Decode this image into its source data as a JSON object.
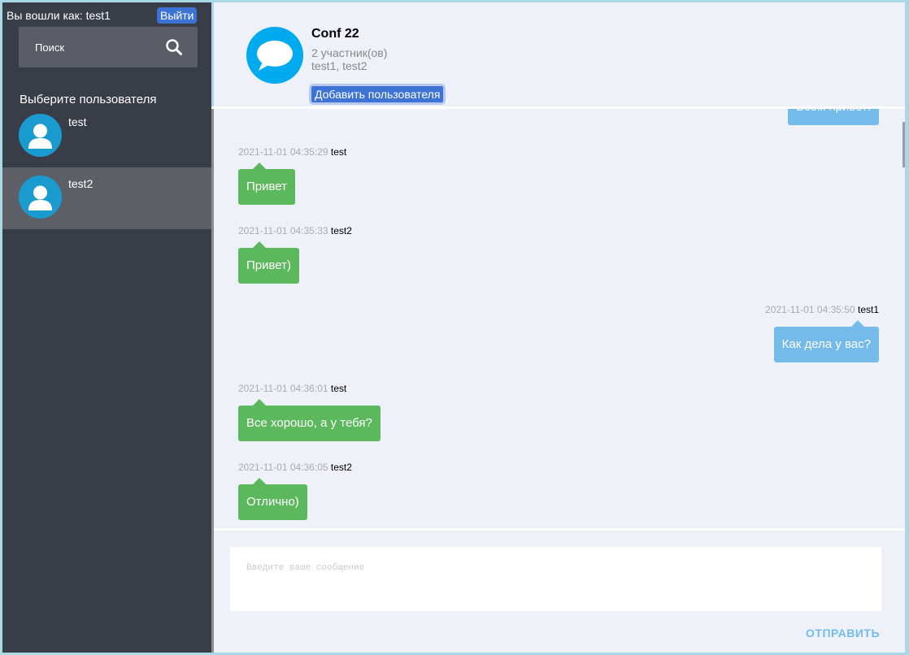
{
  "sidebar": {
    "logged_in_label": "Вы вошли как: test1",
    "logout_label": "Выйти",
    "search_placeholder": "Поиск",
    "choose_user_label": "Выберите пользователя",
    "users": [
      {
        "name": "test",
        "active": false
      },
      {
        "name": "test2",
        "active": true
      }
    ]
  },
  "conversation": {
    "title": "Conf 22",
    "participant_count": "2 участник(ов)",
    "members": "test1, test2",
    "add_user_label": "Добавить пользователя"
  },
  "messages": {
    "partial_top": "Всем привет!",
    "items": [
      {
        "time": "2021-11-01 04:35:29",
        "author": "test",
        "text": "Привет",
        "side": "left"
      },
      {
        "time": "2021-11-01 04:35:33",
        "author": "test2",
        "text": "Привет)",
        "side": "left"
      },
      {
        "time": "2021-11-01 04:35:50",
        "author": "test1",
        "text": "Как дела у вас?",
        "side": "right"
      },
      {
        "time": "2021-11-01 04:36:01",
        "author": "test",
        "text": "Все хорошо, а у тебя?",
        "side": "left"
      },
      {
        "time": "2021-11-01 04:36:05",
        "author": "test2",
        "text": "Отлично)",
        "side": "left"
      }
    ]
  },
  "composer": {
    "placeholder": "Введите ваше сообщение",
    "send_label": "ОТПРАВИТЬ"
  },
  "colors": {
    "sidebar_bg": "#393d47",
    "accent_blue": "#3c73d4",
    "bubble_green": "#5cb85c",
    "bubble_blue": "#74bbea",
    "avatar_blue": "#1a9bd0"
  },
  "icons": {
    "search": "search-icon",
    "user_avatar": "user-silhouette-icon",
    "conference": "chat-bubble-icon"
  }
}
